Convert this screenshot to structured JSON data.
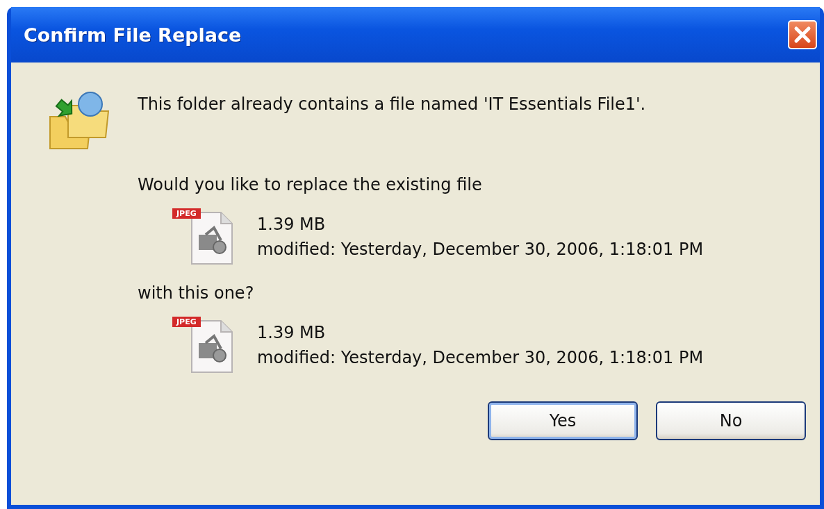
{
  "window": {
    "title": "Confirm File Replace"
  },
  "message": "This folder already contains a file named 'IT Essentials File1'.",
  "question": "Would you like to replace the existing file",
  "existing_file": {
    "badge": "JPEG",
    "size": "1.39 MB",
    "modified": "modified: Yesterday, December 30, 2006, 1:18:01 PM"
  },
  "connector": "with this one?",
  "new_file": {
    "badge": "JPEG",
    "size": "1.39 MB",
    "modified": "modified: Yesterday, December 30, 2006, 1:18:01 PM"
  },
  "buttons": [
    {
      "label": "Yes",
      "default": true
    },
    {
      "label": "No",
      "default": false
    }
  ]
}
